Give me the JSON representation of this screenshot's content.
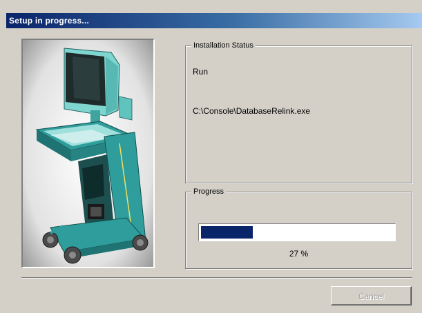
{
  "window": {
    "title": "Setup in progress..."
  },
  "installation_status": {
    "group_label": "Installation Status",
    "action": "Run",
    "file": "C:\\Console\\DatabaseRelink.exe"
  },
  "progress": {
    "group_label": "Progress",
    "percent": 27,
    "percent_text": "27 %",
    "fill_color": "#0a246a"
  },
  "buttons": {
    "cancel_label": "Cancel",
    "cancel_enabled": false
  },
  "illustration": {
    "subject": "ultrasound-cart-illustration",
    "accent_color": "#2e9d9b"
  }
}
